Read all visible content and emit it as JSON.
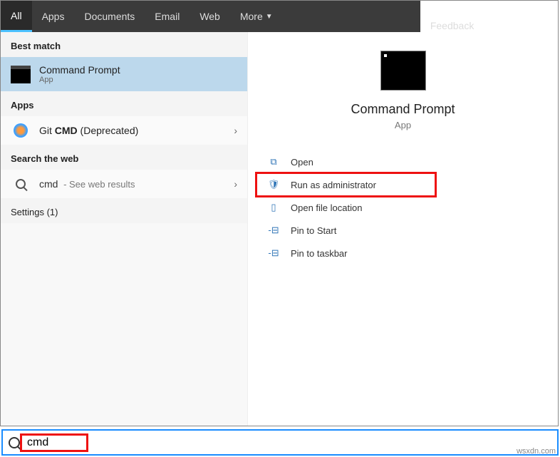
{
  "tabs": {
    "all": "All",
    "apps": "Apps",
    "documents": "Documents",
    "email": "Email",
    "web": "Web",
    "more": "More",
    "feedback": "Feedback"
  },
  "left": {
    "best_match_header": "Best match",
    "best_match": {
      "title": "Command Prompt",
      "subtitle": "App"
    },
    "apps_header": "Apps",
    "git_prefix": "Git ",
    "git_bold": "CMD",
    "git_suffix": " (Deprecated)",
    "search_web_header": "Search the web",
    "web_query": "cmd",
    "web_suffix": " - See web results",
    "settings_header": "Settings (1)"
  },
  "preview": {
    "title": "Command Prompt",
    "type": "App"
  },
  "actions": {
    "open": "Open",
    "run_admin": "Run as administrator",
    "open_loc": "Open file location",
    "pin_start": "Pin to Start",
    "pin_taskbar": "Pin to taskbar"
  },
  "search": {
    "value": "cmd"
  },
  "watermark": "wsxdn.com"
}
